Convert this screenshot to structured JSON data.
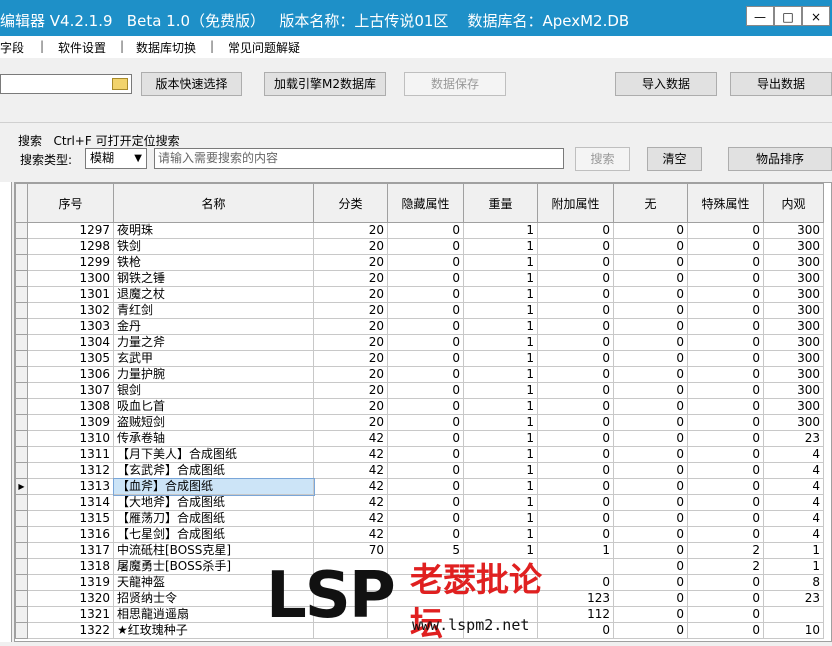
{
  "window": {
    "title": "编辑器 V4.2.1.9   Beta 1.0（免费版）   版本名称：上古传说01区    数据库名：ApexM2.DB",
    "min": "—",
    "max": "□",
    "close": "×"
  },
  "menu": [
    "字段",
    "软件设置",
    "数据库切换",
    "常见问题解疑"
  ],
  "menu_sep": "|",
  "toolbar": {
    "version_select": "版本快速选择",
    "load_engine": "加载引擎M2数据库",
    "save_data": "数据保存",
    "import_data": "导入数据",
    "export_data": "导出数据"
  },
  "search": {
    "hint": "搜索   Ctrl+F 可打开定位搜索",
    "type_label": "搜索类型:",
    "type_value": "模糊",
    "placeholder": "请输入需要搜索的内容",
    "search_btn": "搜索",
    "clear_btn": "清空",
    "sort_btn": "物品排序"
  },
  "table": {
    "headers": [
      "序号",
      "名称",
      "分类",
      "隐藏属性",
      "重量",
      "附加属性",
      "无",
      "特殊属性",
      "内观"
    ],
    "selected_row": 1313,
    "rows": [
      [
        1297,
        "夜明珠",
        20,
        0,
        1,
        0,
        0,
        0,
        300
      ],
      [
        1298,
        "铁剑",
        20,
        0,
        1,
        0,
        0,
        0,
        300
      ],
      [
        1299,
        "铁枪",
        20,
        0,
        1,
        0,
        0,
        0,
        300
      ],
      [
        1300,
        "钢铁之锤",
        20,
        0,
        1,
        0,
        0,
        0,
        300
      ],
      [
        1301,
        "退魔之杖",
        20,
        0,
        1,
        0,
        0,
        0,
        300
      ],
      [
        1302,
        "青红剑",
        20,
        0,
        1,
        0,
        0,
        0,
        300
      ],
      [
        1303,
        "金丹",
        20,
        0,
        1,
        0,
        0,
        0,
        300
      ],
      [
        1304,
        "力量之斧",
        20,
        0,
        1,
        0,
        0,
        0,
        300
      ],
      [
        1305,
        "玄武甲",
        20,
        0,
        1,
        0,
        0,
        0,
        300
      ],
      [
        1306,
        "力量护腕",
        20,
        0,
        1,
        0,
        0,
        0,
        300
      ],
      [
        1307,
        "银剑",
        20,
        0,
        1,
        0,
        0,
        0,
        300
      ],
      [
        1308,
        "吸血匕首",
        20,
        0,
        1,
        0,
        0,
        0,
        300
      ],
      [
        1309,
        "盗贼短剑",
        20,
        0,
        1,
        0,
        0,
        0,
        300
      ],
      [
        1310,
        "传承卷轴",
        42,
        0,
        1,
        0,
        0,
        0,
        23
      ],
      [
        1311,
        "【月下美人】合成图纸",
        42,
        0,
        1,
        0,
        0,
        0,
        4
      ],
      [
        1312,
        "【玄武斧】合成图纸",
        42,
        0,
        1,
        0,
        0,
        0,
        4
      ],
      [
        1313,
        "【血斧】合成图纸",
        42,
        0,
        1,
        0,
        0,
        0,
        4
      ],
      [
        1314,
        "【大地斧】合成图纸",
        42,
        0,
        1,
        0,
        0,
        0,
        4
      ],
      [
        1315,
        "【雁荡刀】合成图纸",
        42,
        0,
        1,
        0,
        0,
        0,
        4
      ],
      [
        1316,
        "【七星剑】合成图纸",
        42,
        0,
        1,
        0,
        0,
        0,
        4
      ],
      [
        1317,
        "中流砥柱[BOSS克星]",
        70,
        5,
        1,
        1,
        0,
        2,
        1
      ],
      [
        1318,
        "屠魔勇士[BOSS杀手]",
        "",
        "",
        "",
        "",
        0,
        2,
        1
      ],
      [
        1319,
        "天龍神盔",
        "",
        "",
        "",
        0,
        0,
        0,
        8
      ],
      [
        1320,
        "招贤纳士令",
        "",
        "",
        "",
        123,
        0,
        0,
        23
      ],
      [
        1321,
        "相思龍逍遥扇",
        "",
        "",
        "",
        112,
        0,
        0,
        ""
      ],
      [
        1322,
        "★红玫瑰种子",
        "",
        "",
        "",
        0,
        0,
        0,
        10
      ]
    ]
  },
  "watermark": {
    "logo": "LSP",
    "cn": "老瑟批论坛",
    "url": "www.lspm2.net"
  }
}
